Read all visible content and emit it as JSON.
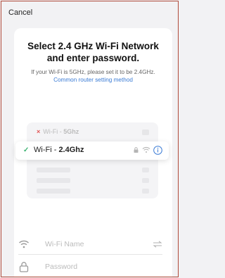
{
  "header": {
    "cancel_label": "Cancel"
  },
  "main": {
    "title_line1": "Select 2.4 GHz Wi-Fi Network",
    "title_line2": "and enter password.",
    "hint_text": "If your Wi-Fi is 5GHz, please set it to be 2.4GHz. ",
    "hint_link": "Common router setting method"
  },
  "illustration": {
    "row_5g": {
      "prefix": "Wi-Fi - ",
      "band": "5Ghz",
      "mark": "×"
    },
    "row_24g": {
      "prefix": "Wi-Fi - ",
      "band": "2.4Ghz",
      "mark": "✓"
    }
  },
  "form": {
    "wifi_name_placeholder": "Wi-Fi Name",
    "password_placeholder": "Password"
  },
  "colors": {
    "link": "#3a7bd5",
    "check": "#3cb371",
    "cross": "#e25555",
    "info": "#3a7bd5"
  },
  "icons": [
    "wifi-icon",
    "lock-icon",
    "info-icon",
    "swap-icon",
    "check-icon",
    "cross-icon"
  ]
}
